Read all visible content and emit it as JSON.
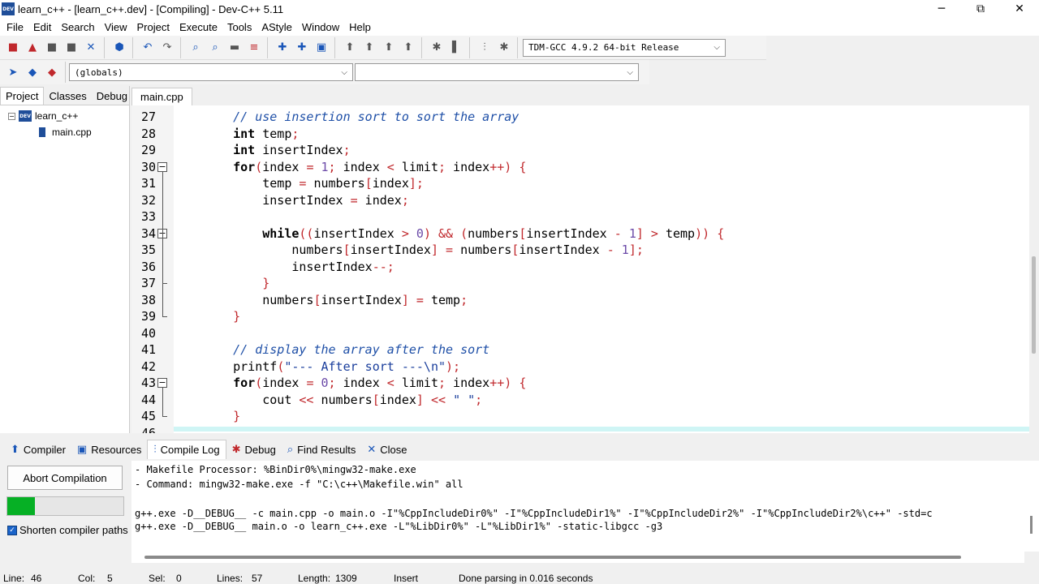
{
  "window": {
    "title": "learn_c++ - [learn_c++.dev] - [Compiling] - Dev-C++ 5.11",
    "icon_text": "DEV",
    "controls": [
      "─",
      "⧉",
      "✕"
    ]
  },
  "menu": [
    "File",
    "Edit",
    "Search",
    "View",
    "Project",
    "Execute",
    "Tools",
    "AStyle",
    "Window",
    "Help"
  ],
  "toolbar": {
    "compiler_select": "TDM-GCC 4.9.2 64-bit Release",
    "scope_select": "(globals)",
    "member_select": ""
  },
  "left_panel": {
    "tabs": [
      "Project",
      "Classes",
      "Debug"
    ],
    "active_tab": "Project",
    "tree": {
      "project": "learn_c++",
      "files": [
        "main.cpp"
      ]
    }
  },
  "editor": {
    "tab": "main.cpp",
    "lines": [
      {
        "n": "27",
        "code": [
          {
            "t": "    "
          },
          {
            "c": "cm",
            "t": "// use insertion sort to sort the array"
          }
        ]
      },
      {
        "n": "28",
        "code": [
          {
            "t": "    "
          },
          {
            "c": "kw",
            "t": "int"
          },
          {
            "t": " temp"
          },
          {
            "c": "sy",
            "t": ";"
          }
        ]
      },
      {
        "n": "29",
        "code": [
          {
            "t": "    "
          },
          {
            "c": "kw",
            "t": "int"
          },
          {
            "t": " insertIndex"
          },
          {
            "c": "sy",
            "t": ";"
          }
        ]
      },
      {
        "n": "30",
        "fold": "open",
        "code": [
          {
            "t": "    "
          },
          {
            "c": "kw",
            "t": "for"
          },
          {
            "c": "sy",
            "t": "("
          },
          {
            "t": "index "
          },
          {
            "c": "sy",
            "t": "="
          },
          {
            "t": " "
          },
          {
            "c": "nu",
            "t": "1"
          },
          {
            "c": "sy",
            "t": ";"
          },
          {
            "t": " index "
          },
          {
            "c": "sy",
            "t": "<"
          },
          {
            "t": " limit"
          },
          {
            "c": "sy",
            "t": ";"
          },
          {
            "t": " index"
          },
          {
            "c": "sy",
            "t": "++)"
          },
          {
            "t": " "
          },
          {
            "c": "sy",
            "t": "{"
          }
        ]
      },
      {
        "n": "31",
        "code": [
          {
            "t": "        temp "
          },
          {
            "c": "sy",
            "t": "="
          },
          {
            "t": " numbers"
          },
          {
            "c": "sy",
            "t": "["
          },
          {
            "t": "index"
          },
          {
            "c": "sy",
            "t": "];"
          }
        ]
      },
      {
        "n": "32",
        "code": [
          {
            "t": "        insertIndex "
          },
          {
            "c": "sy",
            "t": "="
          },
          {
            "t": " index"
          },
          {
            "c": "sy",
            "t": ";"
          }
        ]
      },
      {
        "n": "33",
        "code": []
      },
      {
        "n": "34",
        "fold": "open",
        "code": [
          {
            "t": "        "
          },
          {
            "c": "kw",
            "t": "while"
          },
          {
            "c": "sy",
            "t": "(("
          },
          {
            "t": "insertIndex "
          },
          {
            "c": "sy",
            "t": ">"
          },
          {
            "t": " "
          },
          {
            "c": "nu",
            "t": "0"
          },
          {
            "c": "sy",
            "t": ")"
          },
          {
            "t": " "
          },
          {
            "c": "sy",
            "t": "&&"
          },
          {
            "t": " "
          },
          {
            "c": "sy",
            "t": "("
          },
          {
            "t": "numbers"
          },
          {
            "c": "sy",
            "t": "["
          },
          {
            "t": "insertIndex "
          },
          {
            "c": "sy",
            "t": "-"
          },
          {
            "t": " "
          },
          {
            "c": "nu",
            "t": "1"
          },
          {
            "c": "sy",
            "t": "]"
          },
          {
            "t": " "
          },
          {
            "c": "sy",
            "t": ">"
          },
          {
            "t": " temp"
          },
          {
            "c": "sy",
            "t": "))"
          },
          {
            "t": " "
          },
          {
            "c": "sy",
            "t": "{"
          }
        ]
      },
      {
        "n": "35",
        "code": [
          {
            "t": "            numbers"
          },
          {
            "c": "sy",
            "t": "["
          },
          {
            "t": "insertIndex"
          },
          {
            "c": "sy",
            "t": "]"
          },
          {
            "t": " "
          },
          {
            "c": "sy",
            "t": "="
          },
          {
            "t": " numbers"
          },
          {
            "c": "sy",
            "t": "["
          },
          {
            "t": "insertIndex "
          },
          {
            "c": "sy",
            "t": "-"
          },
          {
            "t": " "
          },
          {
            "c": "nu",
            "t": "1"
          },
          {
            "c": "sy",
            "t": "];"
          }
        ]
      },
      {
        "n": "36",
        "code": [
          {
            "t": "            insertIndex"
          },
          {
            "c": "sy",
            "t": "--;"
          }
        ]
      },
      {
        "n": "37",
        "fold": "end",
        "code": [
          {
            "t": "        "
          },
          {
            "c": "sy",
            "t": "}"
          }
        ]
      },
      {
        "n": "38",
        "code": [
          {
            "t": "        numbers"
          },
          {
            "c": "sy",
            "t": "["
          },
          {
            "t": "insertIndex"
          },
          {
            "c": "sy",
            "t": "]"
          },
          {
            "t": " "
          },
          {
            "c": "sy",
            "t": "="
          },
          {
            "t": " temp"
          },
          {
            "c": "sy",
            "t": ";"
          }
        ]
      },
      {
        "n": "39",
        "fold": "end",
        "code": [
          {
            "t": "    "
          },
          {
            "c": "sy",
            "t": "}"
          }
        ]
      },
      {
        "n": "40",
        "code": []
      },
      {
        "n": "41",
        "code": [
          {
            "t": "    "
          },
          {
            "c": "cm",
            "t": "// display the array after the sort"
          }
        ]
      },
      {
        "n": "42",
        "code": [
          {
            "t": "    printf"
          },
          {
            "c": "sy",
            "t": "("
          },
          {
            "c": "st",
            "t": "\"--- After sort ---\\n\""
          },
          {
            "c": "sy",
            "t": ");"
          }
        ]
      },
      {
        "n": "43",
        "fold": "open",
        "code": [
          {
            "t": "    "
          },
          {
            "c": "kw",
            "t": "for"
          },
          {
            "c": "sy",
            "t": "("
          },
          {
            "t": "index "
          },
          {
            "c": "sy",
            "t": "="
          },
          {
            "t": " "
          },
          {
            "c": "nu",
            "t": "0"
          },
          {
            "c": "sy",
            "t": ";"
          },
          {
            "t": " index "
          },
          {
            "c": "sy",
            "t": "<"
          },
          {
            "t": " limit"
          },
          {
            "c": "sy",
            "t": ";"
          },
          {
            "t": " index"
          },
          {
            "c": "sy",
            "t": "++)"
          },
          {
            "t": " "
          },
          {
            "c": "sy",
            "t": "{"
          }
        ]
      },
      {
        "n": "44",
        "code": [
          {
            "t": "        cout "
          },
          {
            "c": "sy",
            "t": "<<"
          },
          {
            "t": " numbers"
          },
          {
            "c": "sy",
            "t": "["
          },
          {
            "t": "index"
          },
          {
            "c": "sy",
            "t": "]"
          },
          {
            "t": " "
          },
          {
            "c": "sy",
            "t": "<<"
          },
          {
            "t": " "
          },
          {
            "c": "st",
            "t": "\" \""
          },
          {
            "c": "sy",
            "t": ";"
          }
        ]
      },
      {
        "n": "45",
        "fold": "end",
        "code": [
          {
            "t": "    "
          },
          {
            "c": "sy",
            "t": "}"
          }
        ]
      },
      {
        "n": "46",
        "code": []
      }
    ]
  },
  "bottom_panel": {
    "tabs": [
      {
        "label": "Compiler",
        "icon": "compiler-icon"
      },
      {
        "label": "Resources",
        "icon": "resources-icon"
      },
      {
        "label": "Compile Log",
        "icon": "compile-log-icon"
      },
      {
        "label": "Debug",
        "icon": "debug-icon"
      },
      {
        "label": "Find Results",
        "icon": "find-results-icon"
      },
      {
        "label": "Close",
        "icon": "close-icon"
      }
    ],
    "active_tab": "Compile Log",
    "abort_label": "Abort Compilation",
    "progress": 0.24,
    "shorten_label": "Shorten compiler paths",
    "shorten_checked": true,
    "log_lines": [
      "- Makefile Processor: %BinDir0%\\mingw32-make.exe",
      "- Command: mingw32-make.exe -f \"C:\\c++\\Makefile.win\" all",
      "",
      "g++.exe -D__DEBUG__ -c main.cpp -o main.o -I\"%CppIncludeDir0%\" -I\"%CppIncludeDir1%\" -I\"%CppIncludeDir2%\" -I\"%CppIncludeDir2%\\c++\" -std=c",
      "g++.exe -D__DEBUG__ main.o -o learn_c++.exe -L\"%LibDir0%\" -L\"%LibDir1%\" -static-libgcc -g3"
    ]
  },
  "status": {
    "line_label": "Line:",
    "line": "46",
    "col_label": "Col:",
    "col": "5",
    "sel_label": "Sel:",
    "sel": "0",
    "lines_label": "Lines:",
    "lines": "57",
    "length_label": "Length:",
    "length": "1309",
    "mode": "Insert",
    "message": "Done parsing in 0.016 seconds"
  }
}
